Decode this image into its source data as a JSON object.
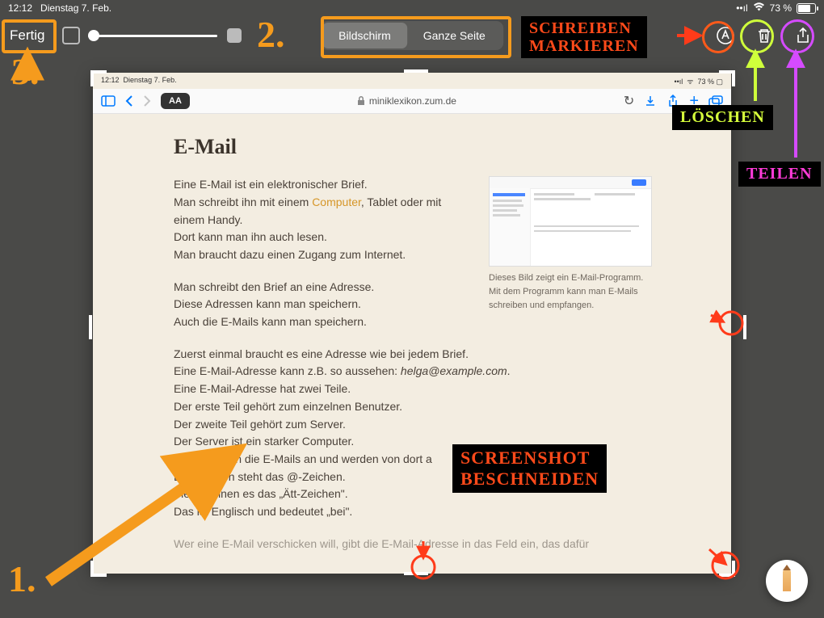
{
  "status": {
    "time": "12:12",
    "date": "Dienstag 7. Feb.",
    "battery": "73 %"
  },
  "toolbar": {
    "done": "Fertig",
    "seg_screen": "Bildschirm",
    "seg_full": "Ganze Seite"
  },
  "screenshot": {
    "status_time": "12:12",
    "status_date": "Dienstag 7. Feb.",
    "status_batt": "73 %",
    "aa": "AA",
    "url": "miniklexikon.zum.de",
    "title": "E-Mail",
    "p1": "Eine E-Mail ist ein elektronischer Brief.\nMan schreibt ihn mit einem ",
    "p1_link": "Computer",
    "p1b": ", Tablet oder mit einem Handy.\nDort kann man ihn auch lesen.\nMan braucht dazu einen Zugang zum Internet.",
    "p2": "Man schreibt den Brief an eine Adresse.\nDiese Adressen kann man speichern.\nAuch die E-Mails kann man speichern.",
    "p3a": "Zuerst einmal braucht es eine Adresse wie bei jedem Brief.\nEine E-Mail-Adresse kann z.B. so aussehen: ",
    "p3_em": "helga@example.com",
    "p3b": ".\nEine E-Mail-Adresse hat zwei Teile.\nDer erste Teil gehört zum einzelnen Benutzer.\nDer zweite Teil gehört zum Server.\nDer Server ist ein starker Computer.\nDort kommen die E-Mails an und werden von dort a\nDazwischen steht das @-Zeichen.\nViele nennen es das „Ätt-Zeichen\".\nDas ist Englisch und bedeutet „bei\".",
    "p4": "Wer eine E-Mail verschicken will, gibt die E-Mail-Adresse in das Feld ein, das dafür",
    "caption": "Dieses Bild zeigt ein E-Mail-Programm. Mit dem Programm kann man E-Mails schreiben und empfangen."
  },
  "anno": {
    "write1": "SCHREIBEN",
    "write2": "MARKIEREN",
    "delete": "LÖSCHEN",
    "share": "TEILEN",
    "crop1": "SCREENSHOT",
    "crop2": "BESCHNEIDEN",
    "n1": "1.",
    "n2": "2.",
    "n3": "3."
  }
}
